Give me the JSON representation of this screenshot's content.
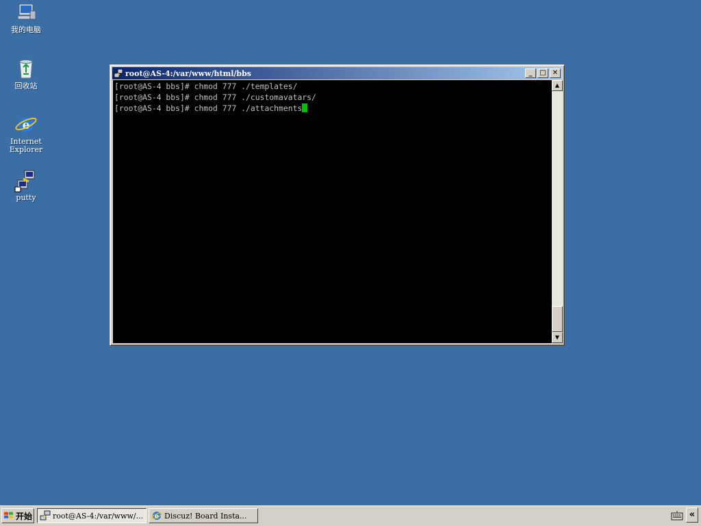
{
  "desktop": {
    "icons": [
      {
        "label": "我的电脑",
        "icon": "my-computer-icon"
      },
      {
        "label": "回收站",
        "icon": "recycle-bin-icon"
      },
      {
        "label": "Internet Explorer",
        "icon": "internet-explorer-icon"
      },
      {
        "label": "putty",
        "icon": "putty-icon"
      }
    ]
  },
  "window": {
    "title": "root@AS-4:/var/www/html/bbs",
    "buttons": {
      "minimize": "_",
      "maximize": "□",
      "close": "✕"
    },
    "terminal_lines": [
      "[root@AS-4 bbs]# chmod 777 ./templates/",
      "[root@AS-4 bbs]# chmod 777 ./customavatars/",
      "[root@AS-4 bbs]# chmod 777 ./attachments"
    ],
    "cursor_color": "#00c000",
    "scrollbar": {
      "up": "▲",
      "down": "▼"
    }
  },
  "taskbar": {
    "start_label": "开始",
    "tasks": [
      {
        "label": "root@AS-4:/var/www/...",
        "icon": "putty-icon",
        "active": true
      },
      {
        "label": "Discuz! Board Insta...",
        "icon": "internet-explorer-icon",
        "active": false
      }
    ],
    "tray": {
      "keyboard": "keyboard-icon",
      "expand": "«"
    }
  },
  "colors": {
    "desktop": "#3a6ea5",
    "titlebar_start": "#0a246a",
    "titlebar_end": "#a6caf0",
    "terminal_bg": "#000000",
    "terminal_fg": "#c0c0c0"
  }
}
